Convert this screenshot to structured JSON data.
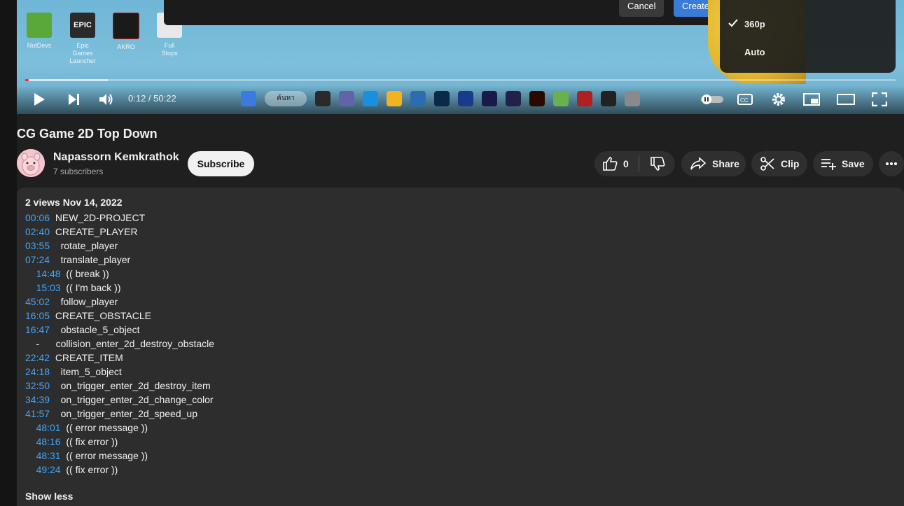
{
  "player": {
    "desktop_icons": [
      {
        "label": "NutDevs",
        "color": "#5aa83a"
      },
      {
        "label": "Epic Games Launcher",
        "color": "#2a2a2a",
        "logo": "EPIC"
      },
      {
        "label": "AKRO",
        "color": "#1a1a1a"
      },
      {
        "label": "Full Stops",
        "color": "#e8e8e8"
      }
    ],
    "dialog": {
      "cancel_label": "Cancel",
      "create_label": "Create pr"
    },
    "time": {
      "current": "0:12",
      "duration": "50:22"
    },
    "progress": {
      "played_fraction": 0.004,
      "buffered_fraction": 0.095
    },
    "taskbar_search": "ค้นหา",
    "taskbar_apps": [
      "#3b7be0",
      "#2a2a2a",
      "#6264a7",
      "#1a8fe0",
      "#f2b320",
      "#2b6db0",
      "#0a2a4a",
      "#1a3a8a",
      "#1a1a4a",
      "#21214a",
      "#2a0a00",
      "#e04e39",
      "#6ab04c",
      "#b02020",
      "#222222",
      "#8a8a8a"
    ],
    "quality_menu": {
      "items": [
        {
          "label": "360p",
          "selected": true
        },
        {
          "label": "Auto",
          "selected": false
        }
      ]
    }
  },
  "video": {
    "title": "CG Game 2D Top Down",
    "channel_name": "Napassorn Kemkrathok",
    "subscribers": "7 subscribers",
    "subscribe_label": "Subscribe",
    "like_count": "0",
    "share_label": "Share",
    "clip_label": "Clip",
    "save_label": "Save"
  },
  "description": {
    "meta": "2 views  Nov 14, 2022",
    "chapters": [
      {
        "ts": "00:06",
        "indent": "",
        "text": "  NEW_2D-PROJECT"
      },
      {
        "ts": "02:40",
        "indent": "",
        "text": "  CREATE_PLAYER"
      },
      {
        "ts": "03:55",
        "indent": "",
        "text": "    rotate_player"
      },
      {
        "ts": "07:24",
        "indent": "",
        "text": "    translate_player"
      },
      {
        "ts": "14:48",
        "indent": "    ",
        "text": "  (( break ))"
      },
      {
        "ts": "15:03",
        "indent": "    ",
        "text": "  (( I'm back ))"
      },
      {
        "ts": "45:02",
        "indent": "",
        "text": "    follow_player"
      },
      {
        "ts": "16:05",
        "indent": "",
        "text": "  CREATE_OBSTACLE"
      },
      {
        "ts": "16:47",
        "indent": "",
        "text": "    obstacle_5_object"
      },
      {
        "ts": "",
        "indent": "    -      ",
        "text": "collision_enter_2d_destroy_obstacle"
      },
      {
        "ts": "22:42",
        "indent": "",
        "text": "  CREATE_ITEM"
      },
      {
        "ts": "24:18",
        "indent": "",
        "text": "    item_5_object"
      },
      {
        "ts": "32:50",
        "indent": "",
        "text": "    on_trigger_enter_2d_destroy_item"
      },
      {
        "ts": "34:39",
        "indent": "",
        "text": "    on_trigger_enter_2d_change_color"
      },
      {
        "ts": "41:57",
        "indent": "",
        "text": "    on_trigger_enter_2d_speed_up"
      },
      {
        "ts": "48:01",
        "indent": "    ",
        "text": "  (( error message ))"
      },
      {
        "ts": "48:16",
        "indent": "    ",
        "text": "  (( fix error ))"
      },
      {
        "ts": "48:31",
        "indent": "    ",
        "text": "  (( error message ))"
      },
      {
        "ts": "49:24",
        "indent": "    ",
        "text": "  (( fix error ))"
      }
    ],
    "show_less_label": "Show less"
  }
}
